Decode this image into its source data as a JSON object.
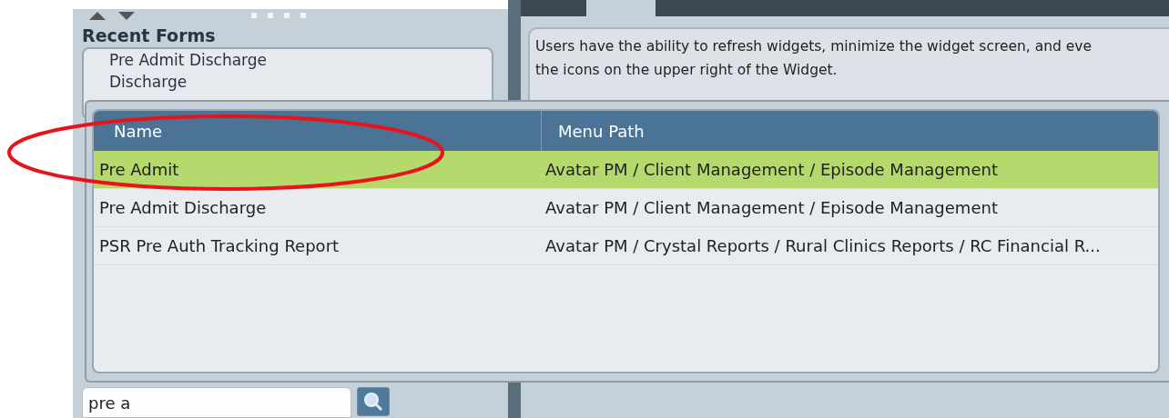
{
  "sidebar": {
    "title": "Recent Forms",
    "recent_forms": [
      "Pre Admit Discharge",
      "Discharge"
    ],
    "search": {
      "value": "pre a"
    }
  },
  "widget": {
    "description_lines": [
      "Users have the ability to refresh widgets, minimize the widget screen, and eve",
      "the icons on the upper right of the Widget."
    ]
  },
  "results": {
    "columns": [
      "Name",
      "Menu Path"
    ],
    "rows": [
      {
        "name": "Pre Admit",
        "menu_path": "Avatar PM / Client Management / Episode Management",
        "selected": true
      },
      {
        "name": "Pre Admit Discharge",
        "menu_path": "Avatar PM / Client Management / Episode Management",
        "selected": false
      },
      {
        "name": "PSR Pre Auth Tracking Report",
        "menu_path": "Avatar PM / Crystal Reports / Rural Clinics Reports / RC Financial R...",
        "selected": false
      }
    ]
  }
}
